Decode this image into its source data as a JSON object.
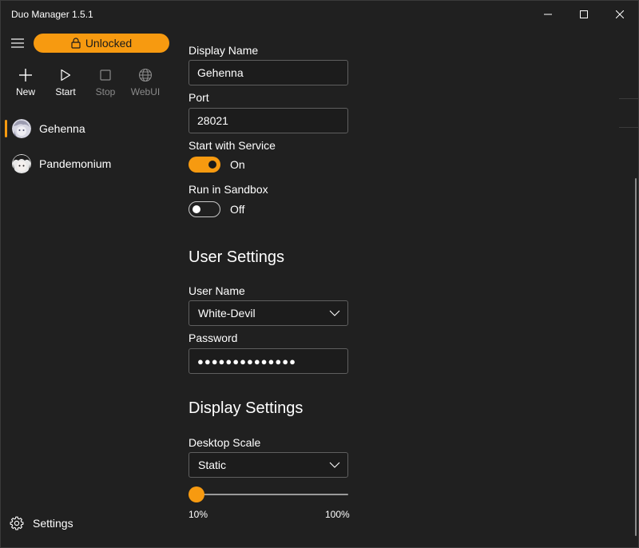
{
  "window": {
    "title": "Duo Manager 1.5.1"
  },
  "sidebar": {
    "lock_label": "Unlocked",
    "toolbar": [
      {
        "label": "New",
        "icon": "plus-icon",
        "enabled": true
      },
      {
        "label": "Start",
        "icon": "play-icon",
        "enabled": true
      },
      {
        "label": "Stop",
        "icon": "stop-icon",
        "enabled": false
      },
      {
        "label": "WebUI",
        "icon": "globe-icon",
        "enabled": false
      }
    ],
    "servers": [
      {
        "name": "Gehenna",
        "active": true
      },
      {
        "name": "Pandemonium",
        "active": false
      }
    ],
    "settings_label": "Settings"
  },
  "server": {
    "display_name_label": "Display Name",
    "display_name": "Gehenna",
    "port_label": "Port",
    "port": "28021",
    "start_with_service_label": "Start with Service",
    "start_with_service_state": "On",
    "run_in_sandbox_label": "Run in Sandbox",
    "run_in_sandbox_state": "Off"
  },
  "user_settings": {
    "heading": "User Settings",
    "user_name_label": "User Name",
    "user_name": "White-Devil",
    "password_label": "Password",
    "password_mask": "●●●●●●●●●●●●●●"
  },
  "display_settings": {
    "heading": "Display Settings",
    "desktop_scale_label": "Desktop Scale",
    "desktop_scale": "Static",
    "slider_min_label": "10%",
    "slider_max_label": "100%",
    "slider_value_fraction": 0.0
  },
  "colors": {
    "accent": "#f79a10",
    "background": "#202020",
    "field_bg": "#1c1c1c"
  }
}
